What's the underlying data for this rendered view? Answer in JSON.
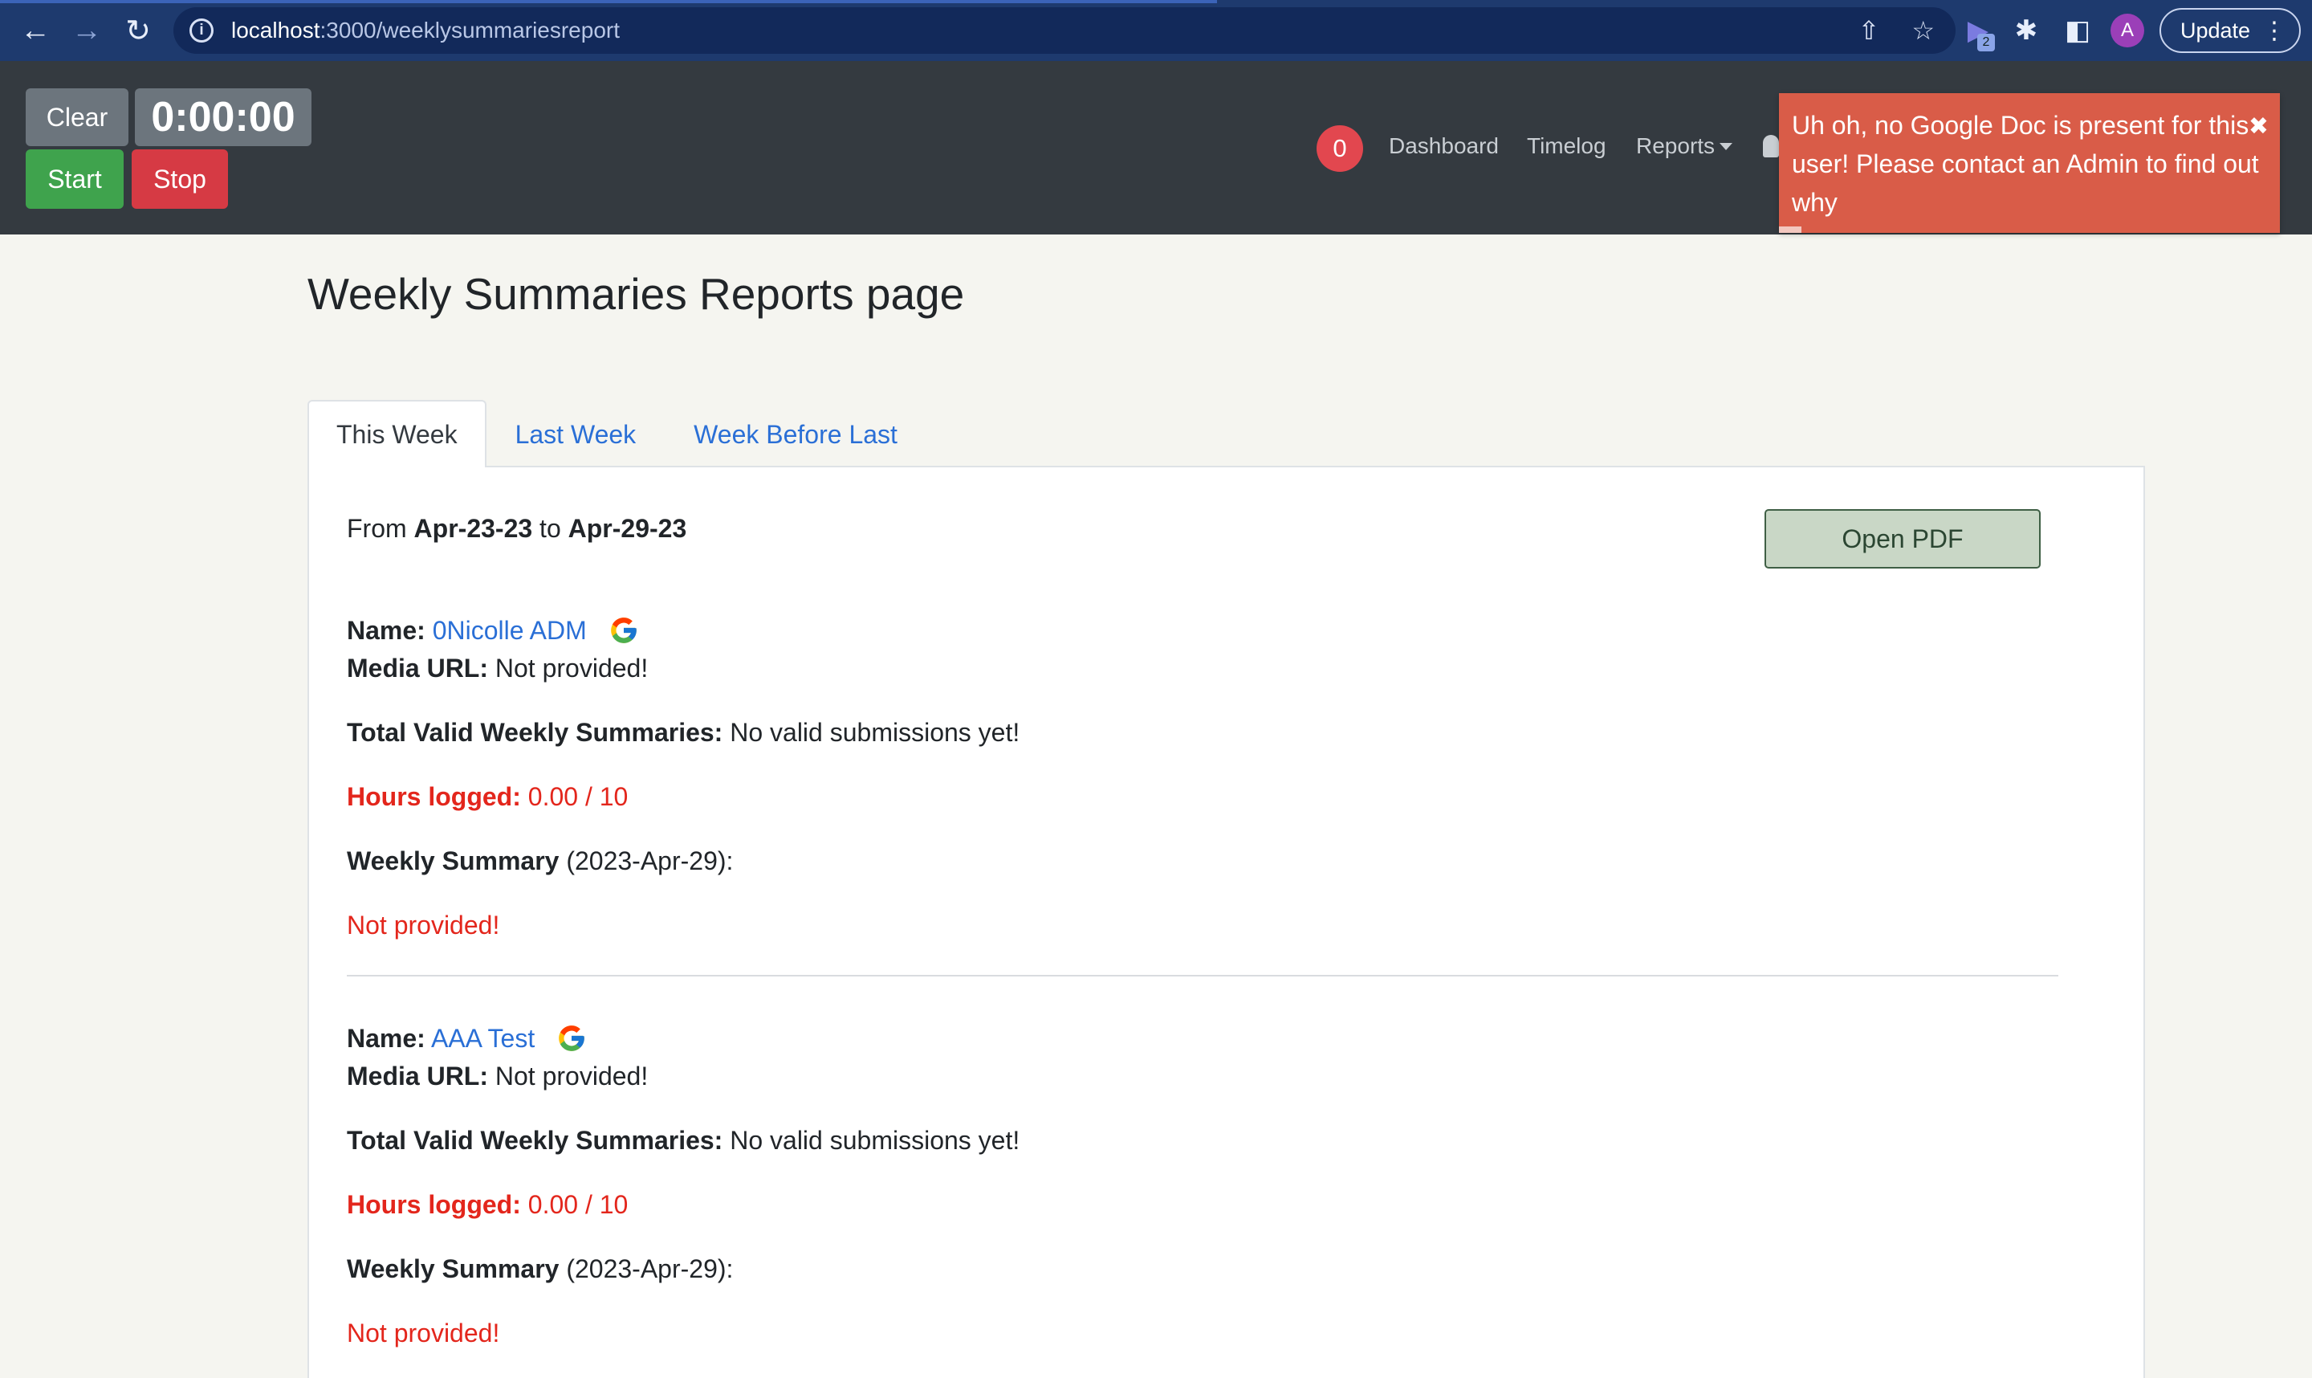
{
  "browser": {
    "url_host": "localhost",
    "url_path": ":3000/weeklysummariesreport",
    "extension_badge": "2",
    "avatar_letter": "A",
    "update_label": "Update"
  },
  "header": {
    "clear_label": "Clear",
    "timer_value": "0:00:00",
    "start_label": "Start",
    "stop_label": "Stop",
    "notification_count": "0",
    "nav": {
      "dashboard": "Dashboard",
      "timelog": "Timelog",
      "reports": "Reports"
    }
  },
  "toast": {
    "message": "Uh oh, no Google Doc is present for this user! Please contact an Admin to find out why",
    "close": "✖"
  },
  "page": {
    "title": "Weekly Summaries Reports page",
    "tabs": [
      "This Week",
      "Last Week",
      "Week Before Last"
    ],
    "from_label": "From",
    "from_date": "Apr-23-23",
    "to_label": "to",
    "to_date": "Apr-29-23",
    "open_pdf": "Open PDF"
  },
  "labels": {
    "name": "Name:",
    "media_url": "Media URL:",
    "total_valid": "Total Valid Weekly Summaries:",
    "hours_logged": "Hours logged:",
    "weekly_summary": "Weekly Summary"
  },
  "users": [
    {
      "name": "0Nicolle ADM",
      "media_url": "Not provided!",
      "total_valid": "No valid submissions yet!",
      "hours": "0.00 / 10",
      "summary_date": "(2023-Apr-29):",
      "summary": "Not provided!"
    },
    {
      "name": "AAA Test",
      "media_url": "Not provided!",
      "total_valid": "No valid submissions yet!",
      "hours": "0.00 / 10",
      "summary_date": "(2023-Apr-29):",
      "summary": "Not provided!"
    }
  ]
}
